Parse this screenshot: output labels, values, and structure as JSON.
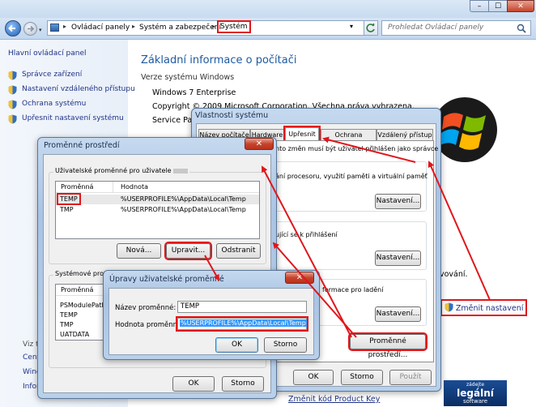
{
  "window_controls": {
    "minimize": "–",
    "maximize": "☐",
    "close": "✕"
  },
  "addressbar": {
    "crumbs": [
      "Ovládací panely",
      "Systém a zabezpečení",
      "Systém"
    ],
    "search_placeholder": "Prohledat Ovládací panely"
  },
  "sidebar": {
    "home": "Hlavní ovládací panel",
    "items": [
      "Správce zařízení",
      "Nastavení vzdáleného přístupu",
      "Ochrana systému",
      "Upřesnit nastavení systému"
    ],
    "see_also_label": "Viz ta",
    "bottom": [
      "Centr",
      "Wind",
      "Inform"
    ]
  },
  "main": {
    "title": "Základní informace o počítači",
    "edition_label": "Verze systému Windows",
    "edition": "Windows 7 Enterprise",
    "copyright": "Copyright © 2009 Microsoft Corporation. Všechna práva vyhrazena.",
    "service_pack": "Service Pack",
    "change_settings": "Změnit nastavení",
    "activation_text": "vování.",
    "change_key": "Změnit kód Product Key",
    "badge_top": "zádejte",
    "badge_main": "legální",
    "badge_bottom": "software"
  },
  "sysprops": {
    "title": "Vlastnosti systému",
    "tabs": [
      "Název počítače",
      "Hardware",
      "Upřesnit",
      "Ochrana systému",
      "Vzdálený přístup"
    ],
    "admin_note": "nto změn musí být uživatel přihlášen jako správce",
    "perf_text": "ání procesoru, využití paměti a virtuální paměť",
    "profile_text": "ující se k přihlášení",
    "startup_text": "formace pro ladění",
    "settings_button": "Nastavení...",
    "env_button": "Proměnné prostředí...",
    "ok": "OK",
    "cancel": "Storno",
    "apply": "Použít"
  },
  "env": {
    "title": "Proměnné prostředí",
    "user_group": "Uživatelské proměnné pro uživatele",
    "system_group": "Systémové proměnné",
    "col_name": "Proměnná",
    "col_value": "Hodnota",
    "user_vars": [
      {
        "name": "TEMP",
        "value": "%USERPROFILE%\\AppData\\Local\\Temp"
      },
      {
        "name": "TMP",
        "value": "%USERPROFILE%\\AppData\\Local\\Temp"
      }
    ],
    "system_vars": [
      "PSModulePath",
      "TEMP",
      "TMP",
      "UATDATA"
    ],
    "new": "Nová...",
    "edit": "Upravit...",
    "delete": "Odstranit",
    "ok": "OK",
    "cancel": "Storno"
  },
  "edit_dialog": {
    "title": "Úpravy uživatelské proměnné",
    "name_label": "Název proměnné:",
    "name_value": "TEMP",
    "value_label": "Hodnota proměnné:",
    "value_value": "%USERPROFILE%\\AppData\\Local\\Temp",
    "ok": "OK",
    "cancel": "Storno"
  },
  "colors": {
    "highlight": "#e0161b",
    "link": "#1e3287",
    "title": "#1e5aa0"
  }
}
